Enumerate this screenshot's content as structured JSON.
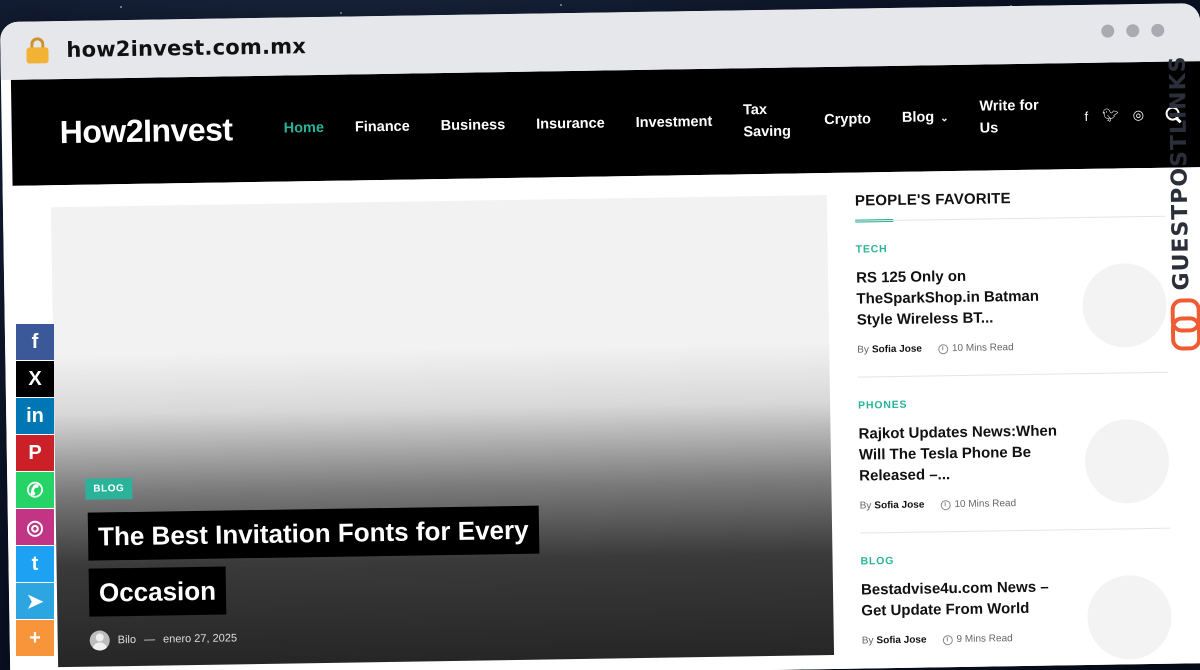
{
  "browser": {
    "url": "how2invest.com.mx"
  },
  "site": {
    "logo": "How2Invest",
    "nav": [
      {
        "label": "Home",
        "active": true
      },
      {
        "label": "Finance"
      },
      {
        "label": "Business"
      },
      {
        "label": "Insurance"
      },
      {
        "label": "Investment"
      },
      {
        "label": "Tax Saving"
      },
      {
        "label": "Crypto"
      },
      {
        "label": "Blog",
        "dropdown": true
      },
      {
        "label": "Write for Us"
      }
    ],
    "social_icons": [
      "facebook-icon",
      "twitter-icon",
      "instagram-icon"
    ],
    "accent_color": "#2ab39a"
  },
  "hero": {
    "category": "BLOG",
    "title": "The Best Invitation Fonts for Every Occasion",
    "author": "Bilo",
    "date": "enero 27, 2025"
  },
  "sidebar": {
    "title": "PEOPLE'S FAVORITE",
    "posts": [
      {
        "category": "TECH",
        "title": "RS 125 Only on TheSparkShop.in Batman Style Wireless BT...",
        "by": "By",
        "author": "Sofia Jose",
        "read_time": "10 Mins Read"
      },
      {
        "category": "PHONES",
        "title": "Rajkot Updates News:When Will The Tesla Phone Be Released –...",
        "by": "By",
        "author": "Sofia Jose",
        "read_time": "10 Mins Read"
      },
      {
        "category": "BLOG",
        "title": "Bestadvise4u.com News – Get Update From World",
        "by": "By",
        "author": "Sofia Jose",
        "read_time": "9 Mins Read"
      }
    ]
  },
  "share_bar": [
    {
      "icon": "facebook-icon",
      "glyph": "f",
      "color": "#3b5998"
    },
    {
      "icon": "x-icon",
      "glyph": "X",
      "color": "#000000"
    },
    {
      "icon": "linkedin-icon",
      "glyph": "in",
      "color": "#0077b5"
    },
    {
      "icon": "pinterest-icon",
      "glyph": "P",
      "color": "#cb2027"
    },
    {
      "icon": "whatsapp-icon",
      "glyph": "✆",
      "color": "#25d366"
    },
    {
      "icon": "instagram-icon",
      "glyph": "◎",
      "color": "#c13584"
    },
    {
      "icon": "twitter-icon",
      "glyph": "t",
      "color": "#1da1f2"
    },
    {
      "icon": "telegram-icon",
      "glyph": "➤",
      "color": "#2ca5e0"
    },
    {
      "icon": "more-icon",
      "glyph": "+",
      "color": "#f8943a"
    }
  ],
  "watermark": {
    "text": "GUESTPOSTLINKS"
  }
}
